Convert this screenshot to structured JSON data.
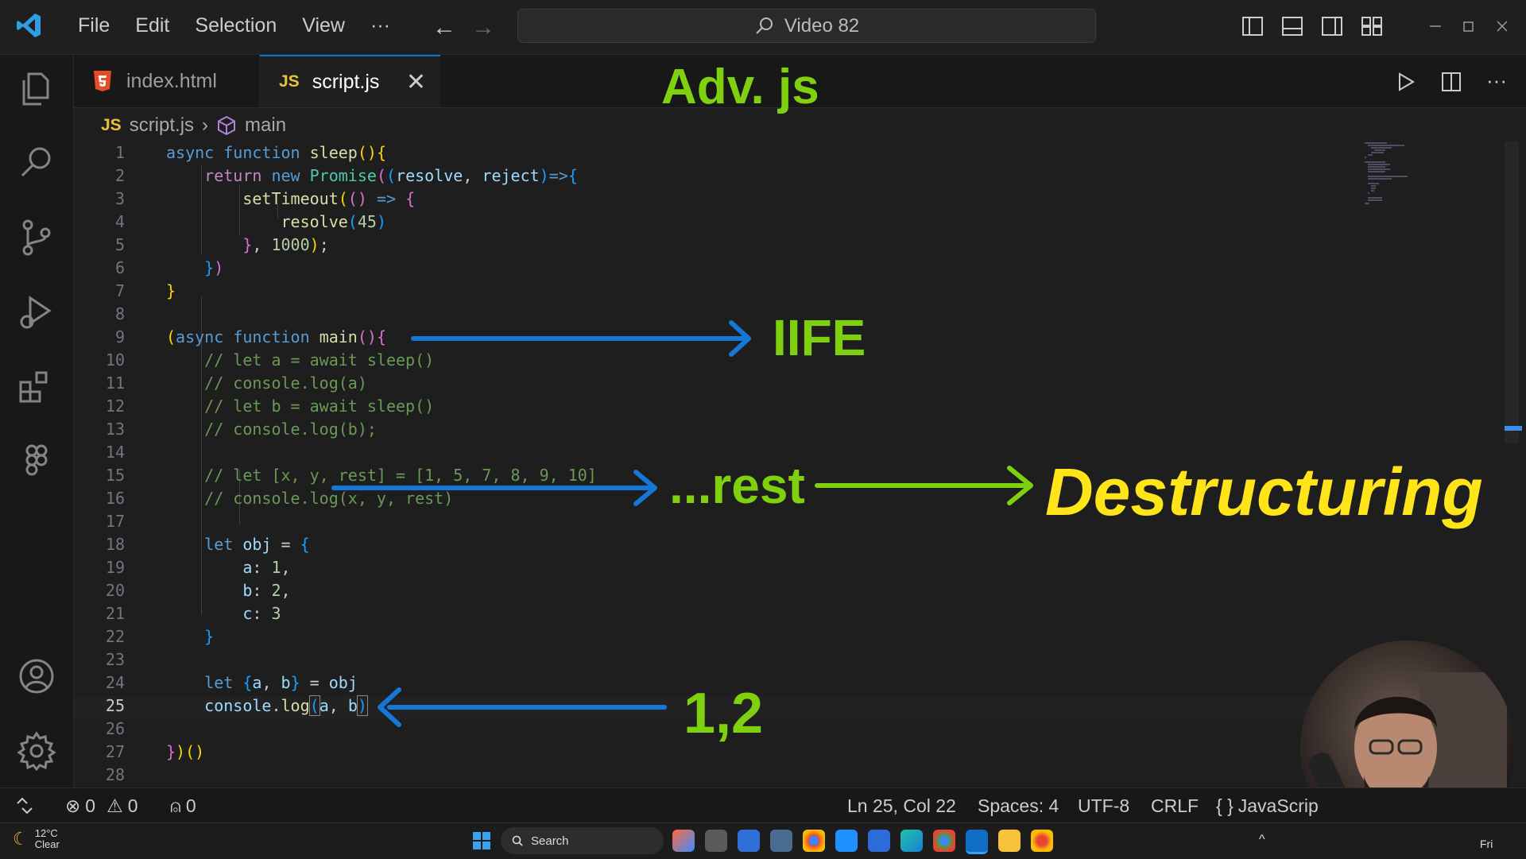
{
  "titlebar": {
    "menu": [
      "File",
      "Edit",
      "Selection",
      "View",
      "···"
    ],
    "command_center": "Video 82"
  },
  "tabs": [
    {
      "label": "index.html",
      "icon": "html5-icon"
    },
    {
      "label": "script.js",
      "badge": "JS",
      "active": true
    }
  ],
  "breadcrumb": {
    "badge": "JS",
    "file": "script.js",
    "symbol": "main"
  },
  "code_lines": [
    "async function sleep(){",
    "    return new Promise((resolve, reject)=>{",
    "        setTimeout(() => {",
    "            resolve(45)",
    "        }, 1000);",
    "    })",
    "}",
    "",
    "(async function main(){",
    "    // let a = await sleep()",
    "    // console.log(a)",
    "    // let b = await sleep()",
    "    // console.log(b);",
    "",
    "    // let [x, y, rest] = [1, 5, 7, 8, 9, 10]",
    "    // console.log(x, y, rest)",
    "",
    "    let obj = {",
    "        a: 1,",
    "        b: 2,",
    "        c: 3",
    "    }",
    "",
    "    let {a, b} = obj",
    "    console.log(a, b)",
    "",
    "})()",
    ""
  ],
  "current_line": 25,
  "annotations": {
    "title": "Adv. js",
    "iife": "IIFE",
    "rest": "...rest",
    "destructuring": "Destructuring",
    "output": "1,2"
  },
  "statusbar": {
    "errors": "0",
    "warnings": "0",
    "ports": "0",
    "position": "Ln 25, Col 22",
    "spaces": "Spaces: 4",
    "encoding": "UTF-8",
    "eol": "CRLF",
    "language": "JavaScrip"
  },
  "taskbar": {
    "temp": "12°C",
    "condition": "Clear",
    "search": "Search",
    "day": "Fri"
  },
  "colors": {
    "accent": "#0078d4",
    "annotation_green": "#7fd10f",
    "annotation_blue": "#1577d6",
    "annotation_yellow": "#ffe41a"
  }
}
